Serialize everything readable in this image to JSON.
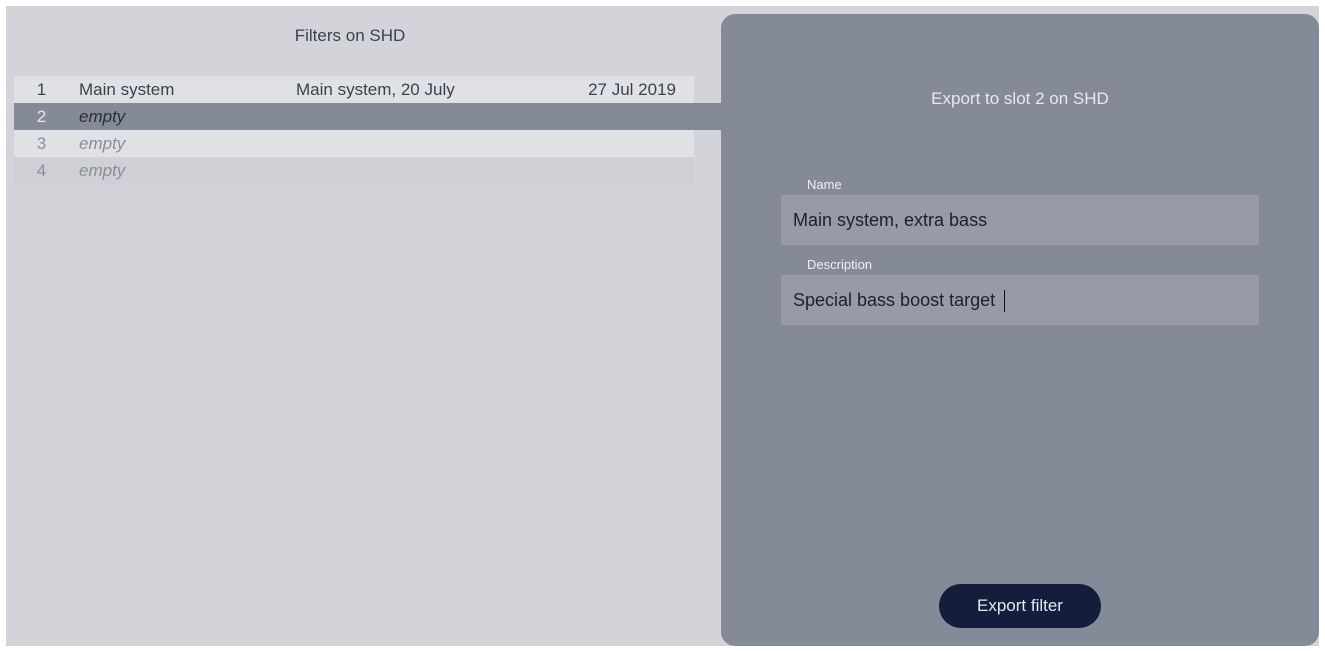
{
  "list": {
    "title": "Filters on SHD",
    "rows": [
      {
        "num": "1",
        "name": "Main system",
        "description": "Main system, 20 July",
        "date": "27 Jul 2019"
      },
      {
        "num": "2",
        "name": "empty",
        "description": "",
        "date": ""
      },
      {
        "num": "3",
        "name": "empty",
        "description": "",
        "date": ""
      },
      {
        "num": "4",
        "name": "empty",
        "description": "",
        "date": ""
      }
    ]
  },
  "export": {
    "title": "Export to slot 2 on SHD",
    "name_label": "Name",
    "name_value": "Main system, extra bass",
    "description_label": "Description",
    "description_value": "Special bass boost target",
    "button_label": "Export filter"
  },
  "colors": {
    "background": "#d3d4d9",
    "panel": "#858a99",
    "selected_row": "#858a99",
    "button": "#141d3b"
  }
}
